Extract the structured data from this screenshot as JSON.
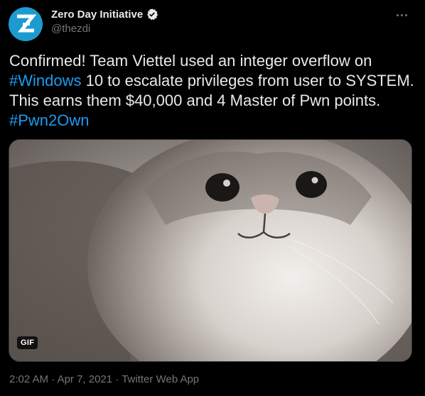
{
  "author": {
    "display_name": "Zero Day Initiative",
    "handle": "@thezdi",
    "avatar_letter": "Z",
    "verified": true
  },
  "tweet": {
    "text_1": "Confirmed! Team Viettel used an integer overflow on ",
    "hashtag_1": "#Windows",
    "text_2": " 10 to escalate privileges from user to SYSTEM. This earns them $40,000 and 4 Master of Pwn points. ",
    "hashtag_2": "#Pwn2Own"
  },
  "media": {
    "type": "gif",
    "badge": "GIF",
    "description_icon": "cat-gif-image"
  },
  "meta": {
    "time": "2:02 AM",
    "separator_1": " · ",
    "date": "Apr 7, 2021",
    "separator_2": " · ",
    "source": "Twitter Web App"
  },
  "colors": {
    "background": "#000000",
    "text": "#e7e9ea",
    "secondary": "#71767b",
    "accent": "#1d9bf0",
    "avatar_bg": "#1d9bd1"
  }
}
